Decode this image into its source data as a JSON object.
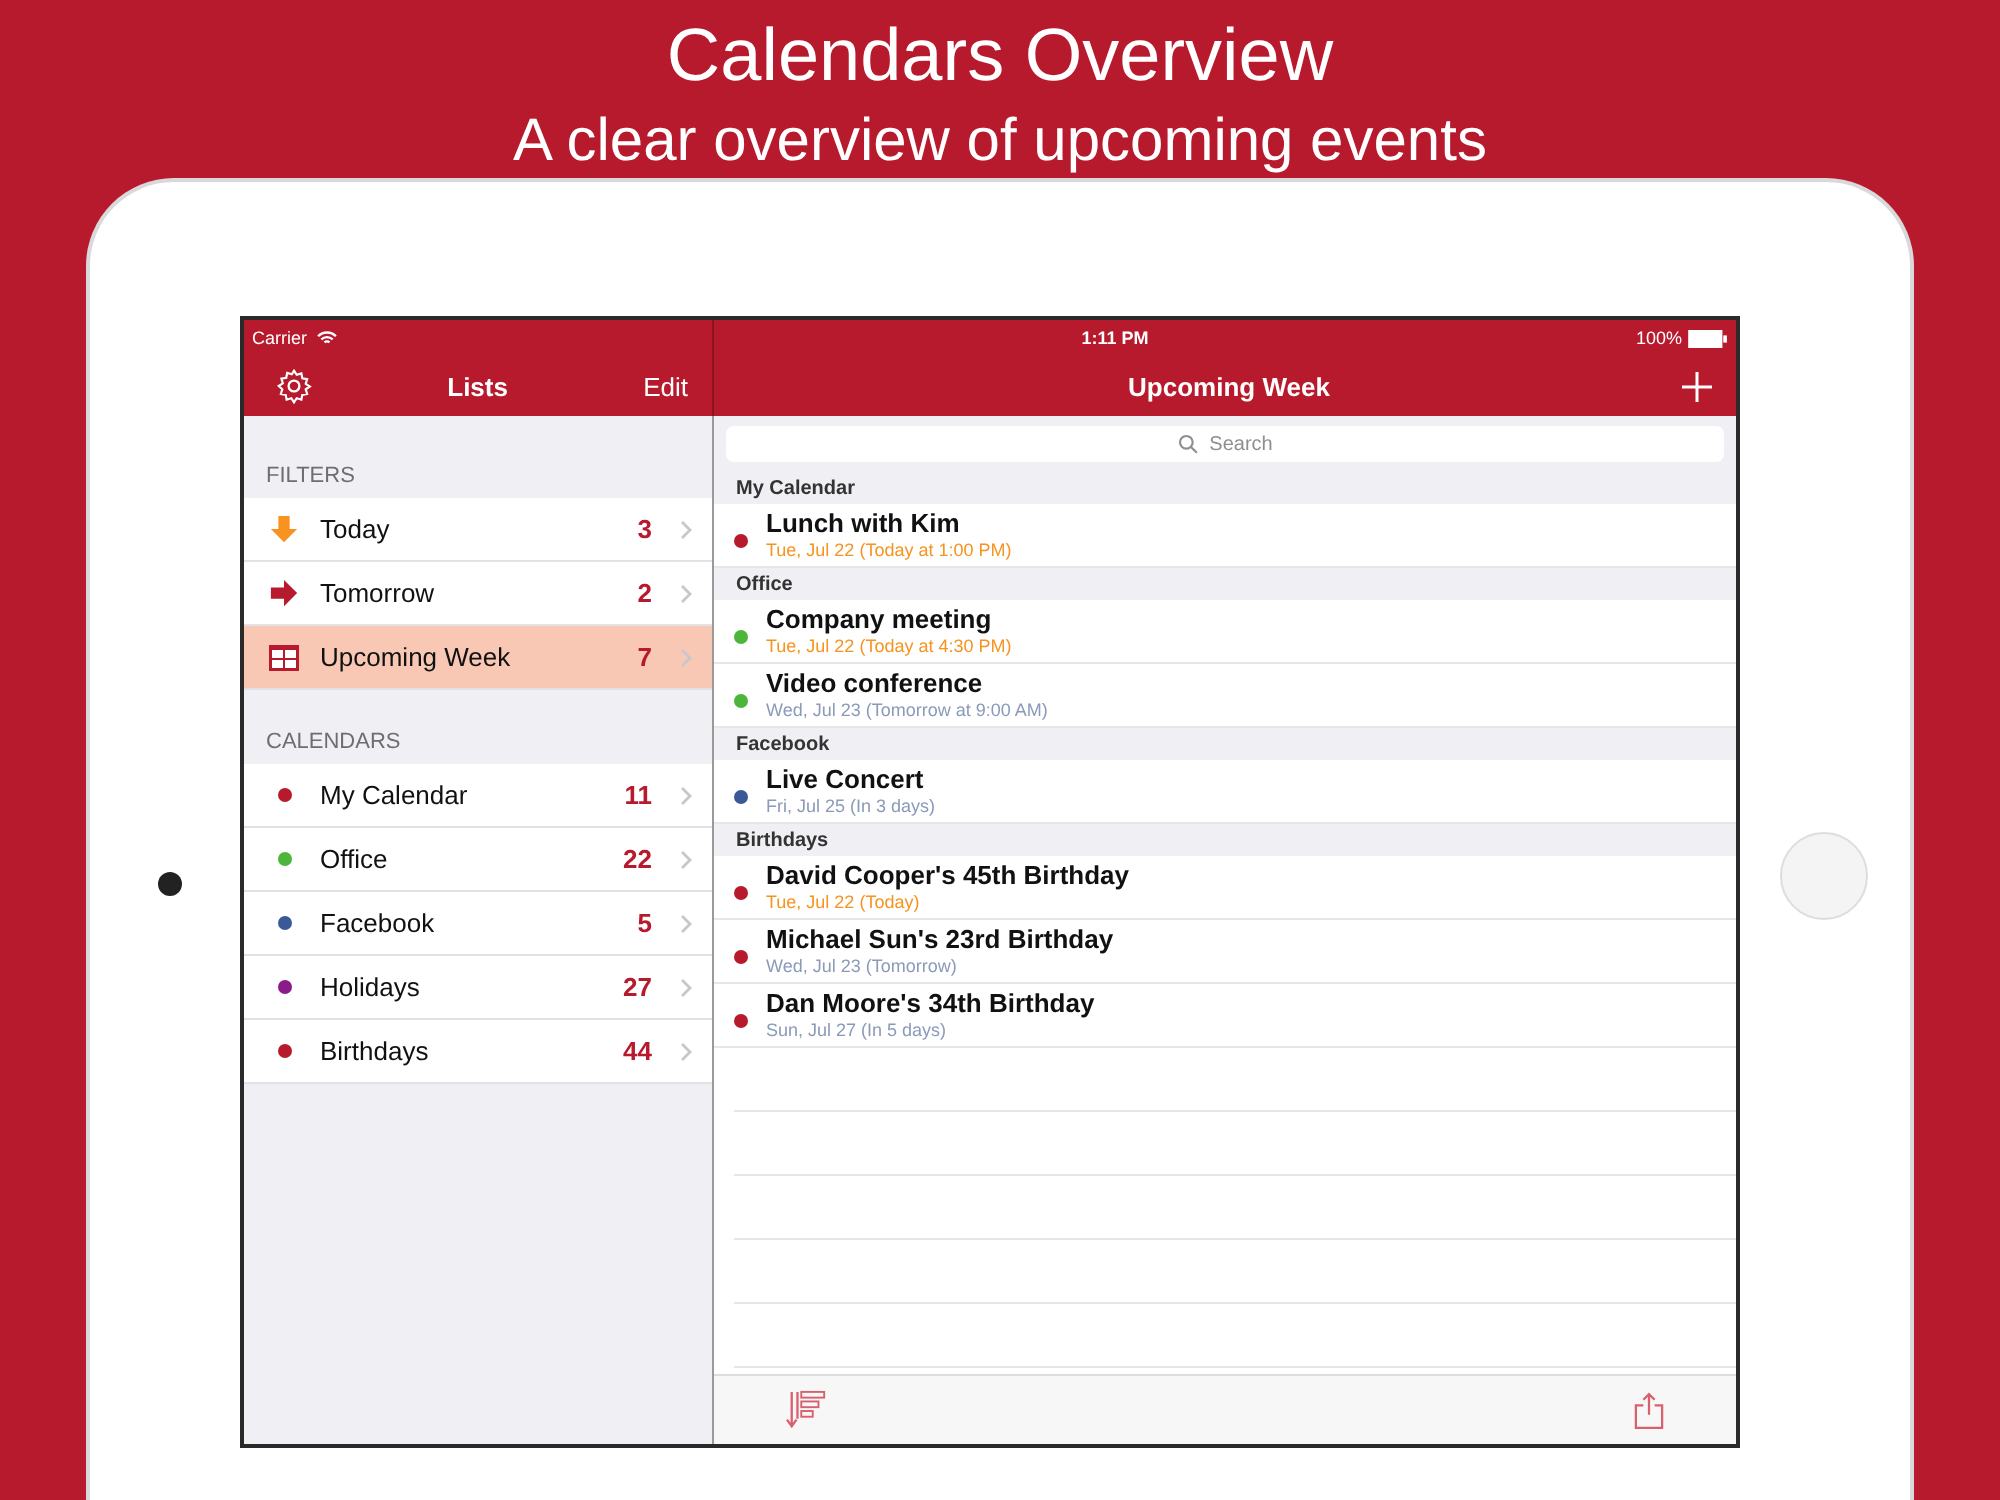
{
  "promo": {
    "title": "Calendars Overview",
    "subtitle": "A clear overview of upcoming events"
  },
  "status_bar": {
    "carrier": "Carrier",
    "time": "1:11 PM",
    "battery": "100%"
  },
  "sidebar": {
    "title": "Lists",
    "edit": "Edit",
    "filters_header": "FILTERS",
    "filters": [
      {
        "kind": "today",
        "label": "Today",
        "count": "3",
        "selected": false
      },
      {
        "kind": "tomorrow",
        "label": "Tomorrow",
        "count": "2",
        "selected": false
      },
      {
        "kind": "week",
        "label": "Upcoming Week",
        "count": "7",
        "selected": true
      }
    ],
    "calendars_header": "CALENDARS",
    "calendars": [
      {
        "label": "My Calendar",
        "count": "11",
        "color": "#b71a2d"
      },
      {
        "label": "Office",
        "count": "22",
        "color": "#4cb53a"
      },
      {
        "label": "Facebook",
        "count": "5",
        "color": "#3b5998"
      },
      {
        "label": "Holidays",
        "count": "27",
        "color": "#8b1a8b"
      },
      {
        "label": "Birthdays",
        "count": "44",
        "color": "#b71a2d"
      }
    ]
  },
  "main": {
    "title": "Upcoming Week",
    "search": {
      "placeholder": "Search"
    },
    "sections": [
      {
        "name": "My Calendar",
        "events": [
          {
            "title": "Lunch with Kim",
            "when": "Tue, Jul 22 (Today at 1:00 PM)",
            "today": true,
            "color": "#b71a2d"
          }
        ]
      },
      {
        "name": "Office",
        "events": [
          {
            "title": "Company meeting",
            "when": "Tue, Jul 22 (Today at 4:30 PM)",
            "today": true,
            "color": "#4cb53a"
          },
          {
            "title": "Video conference",
            "when": "Wed, Jul 23 (Tomorrow at 9:00 AM)",
            "today": false,
            "color": "#4cb53a"
          }
        ]
      },
      {
        "name": "Facebook",
        "events": [
          {
            "title": "Live Concert",
            "when": "Fri, Jul 25 (In 3 days)",
            "today": false,
            "color": "#3b5998"
          }
        ]
      },
      {
        "name": "Birthdays",
        "events": [
          {
            "title": "David Cooper's 45th Birthday",
            "when": "Tue, Jul 22 (Today)",
            "today": true,
            "color": "#b71a2d"
          },
          {
            "title": "Michael Sun's 23rd Birthday",
            "when": "Wed, Jul 23 (Tomorrow)",
            "today": false,
            "color": "#b71a2d"
          },
          {
            "title": "Dan Moore's 34th Birthday",
            "when": "Sun, Jul 27 (In 5 days)",
            "today": false,
            "color": "#b71a2d"
          }
        ]
      }
    ]
  }
}
